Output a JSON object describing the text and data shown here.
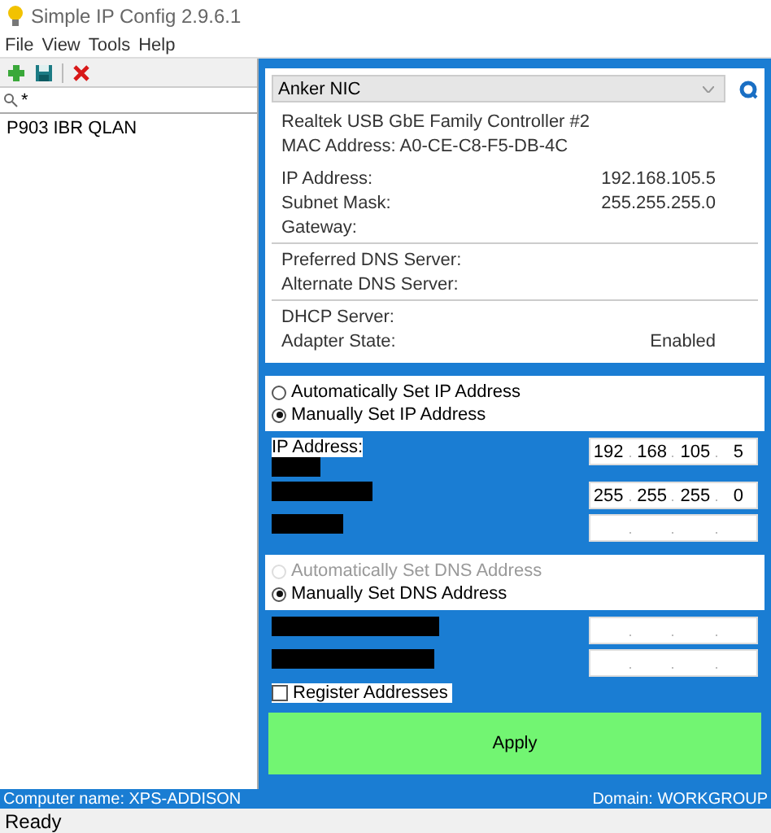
{
  "window": {
    "title": "Simple IP Config 2.9.6.1"
  },
  "menu": [
    "File",
    "View",
    "Tools",
    "Help"
  ],
  "search": {
    "value": "*"
  },
  "profiles": [
    {
      "name": "P903 IBR QLAN",
      "selected": false
    }
  ],
  "adapter": {
    "name": "Anker NIC",
    "description": "Realtek USB GbE Family Controller #2",
    "mac": "MAC Address: A0-CE-C8-F5-DB-4C",
    "sections": [
      [
        {
          "label": "IP Address:",
          "value": "192.168.105.5"
        },
        {
          "label": "Subnet Mask:",
          "value": "255.255.255.0"
        },
        {
          "label": "Gateway:"
        }
      ],
      [
        {
          "label": "Preferred DNS Server:"
        },
        {
          "label": "Alternate DNS Server:"
        }
      ],
      [
        {
          "label": "DHCP Server:"
        },
        {
          "label": "Adapter State:",
          "value": "Enabled"
        }
      ]
    ]
  },
  "ip_mode": [
    {
      "label": "Automatically Set IP Address",
      "selected": false,
      "disabled": false
    },
    {
      "label": "Manually Set IP Address",
      "selected": true,
      "disabled": false
    }
  ],
  "ip_fields": [
    {
      "label": "IP Address:",
      "redacted": true,
      "octets": [
        "192",
        "168",
        "105",
        "5"
      ]
    },
    {
      "redacted": true,
      "octets": [
        "255",
        "255",
        "255",
        "0"
      ]
    },
    {
      "redacted": true
    }
  ],
  "dns_mode": [
    {
      "label": "Automatically Set DNS Address",
      "selected": false,
      "disabled": true
    },
    {
      "label": "Manually Set DNS Address",
      "selected": true,
      "disabled": false
    }
  ],
  "dns_fields": [
    {
      "redacted": true
    },
    {
      "redacted": true
    }
  ],
  "register": {
    "label": "Register Addresses",
    "checked": false
  },
  "apply": "Apply",
  "footer": {
    "computer": "Computer name: XPS-ADDISON",
    "domain": "Domain: WORKGROUP"
  },
  "status": "Ready"
}
